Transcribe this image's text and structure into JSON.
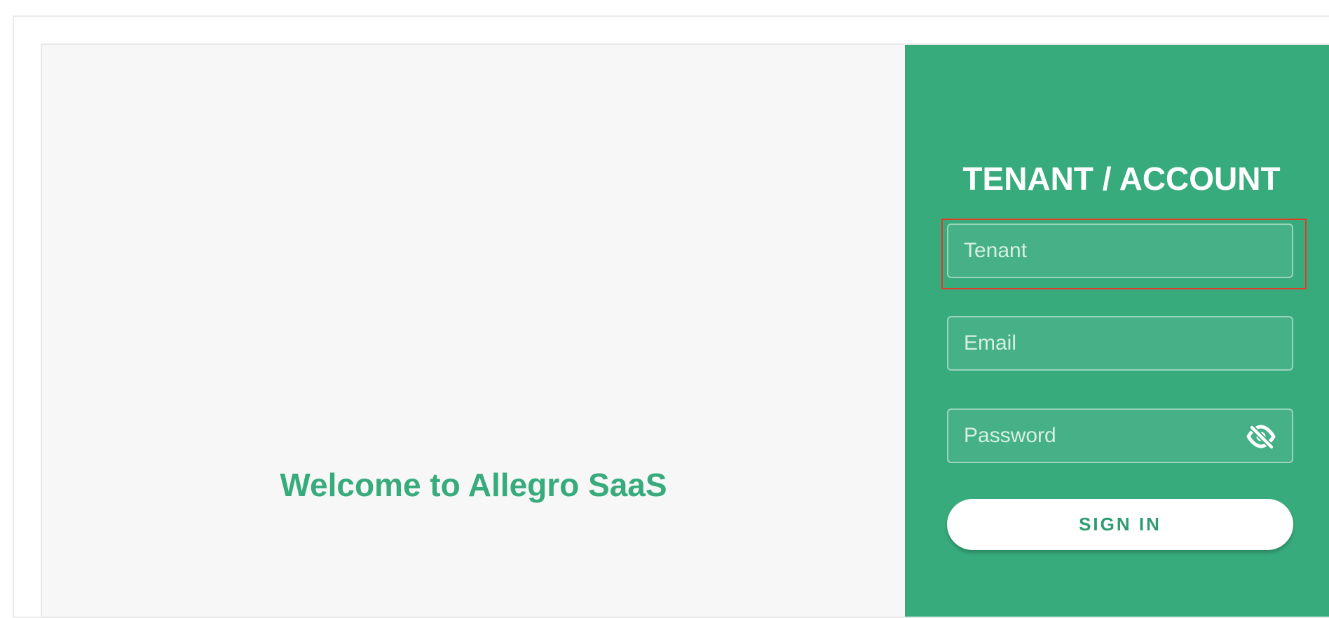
{
  "welcome": {
    "title": "Welcome to Allegro SaaS"
  },
  "login": {
    "title": "TENANT / ACCOUNT",
    "tenant_placeholder": "Tenant",
    "email_placeholder": "Email",
    "password_placeholder": "Password",
    "password_toggle_icon": "eye-slash-icon",
    "signin_label": "SIGN IN"
  },
  "colors": {
    "brand_green": "#37ab7c",
    "panel_background": "#f7f7f7",
    "focus_outline": "#e23c2a"
  }
}
